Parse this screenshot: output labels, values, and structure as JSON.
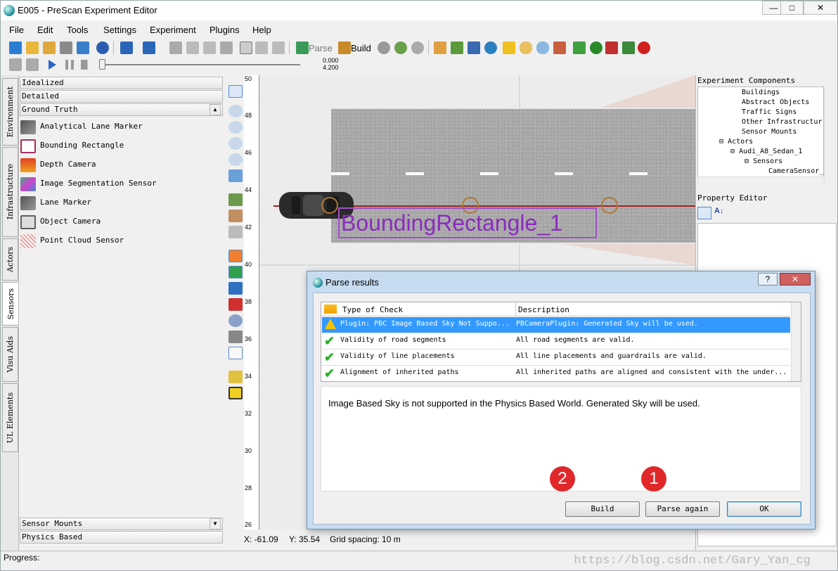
{
  "window": {
    "title": "E005 - PreScan Experiment Editor"
  },
  "menu": [
    "File",
    "Edit",
    "Tools",
    "Settings",
    "Experiment",
    "Plugins",
    "Help"
  ],
  "toolbar": {
    "parse_label": "Parse",
    "build_label": "Build"
  },
  "playback": {
    "time_top": "0.000",
    "time_bottom": "4.200"
  },
  "left_tabs": [
    "Environment",
    "Infrastructure",
    "Actors",
    "Sensors",
    "Visu Aids",
    "UL Elements"
  ],
  "library": {
    "top_categories": [
      "Idealized",
      "Detailed",
      "Ground Truth"
    ],
    "items": [
      "Analytical Lane Marker",
      "Bounding Rectangle",
      "Depth Camera",
      "Image Segmentation Sensor",
      "Lane Marker",
      "Object Camera",
      "Point Cloud Sensor"
    ],
    "bottom_categories": [
      "Sensor Mounts",
      "Physics Based"
    ]
  },
  "ruler": [
    "50",
    "48",
    "46",
    "44",
    "42",
    "40",
    "38",
    "36",
    "34",
    "32",
    "30",
    "28",
    "26"
  ],
  "scene": {
    "object_label": "BoundingRectangle_1"
  },
  "status": {
    "x": "X: -61.09",
    "y": "Y: 35.54",
    "grid": "Grid spacing: 10 m",
    "progress": "Progress:"
  },
  "right_panel": {
    "components_title": "Experiment Components",
    "tree": [
      "Buildings",
      "Abstract Objects",
      "Traffic Signs",
      "Other Infrastructur",
      "Sensor Mounts",
      "Actors",
      "Audi_A8_Sedan_1",
      "Sensors",
      "CameraSensor_"
    ],
    "property_title": "Property Editor"
  },
  "dialog": {
    "title": "Parse results",
    "col_type": "Type of Check",
    "col_desc": "Description",
    "rows": [
      {
        "type": "Plugin: PBC Image Based Sky Not Suppo...",
        "desc": "PBCameraPlugin: Generated Sky will be used.",
        "status": "warning"
      },
      {
        "type": "Validity of road segments",
        "desc": "All road segments are valid.",
        "status": "ok"
      },
      {
        "type": "Validity of line placements",
        "desc": "All line placements and guardrails are valid.",
        "status": "ok"
      },
      {
        "type": "Alignment of inherited paths",
        "desc": "All inherited paths are aligned and consistent with the under...",
        "status": "ok"
      }
    ],
    "detail": "Image Based Sky is not supported in the Physics Based World. Generated Sky will be used.",
    "buttons": {
      "build": "Build",
      "parse_again": "Parse again",
      "ok": "OK"
    },
    "badges": {
      "build": "2",
      "parse_again": "1"
    }
  },
  "watermark": "https://blog.csdn.net/Gary_Yan_cg",
  "colors": {
    "accent": "#3399ff",
    "badge": "#e0282a",
    "label": "#8b2ac0"
  }
}
